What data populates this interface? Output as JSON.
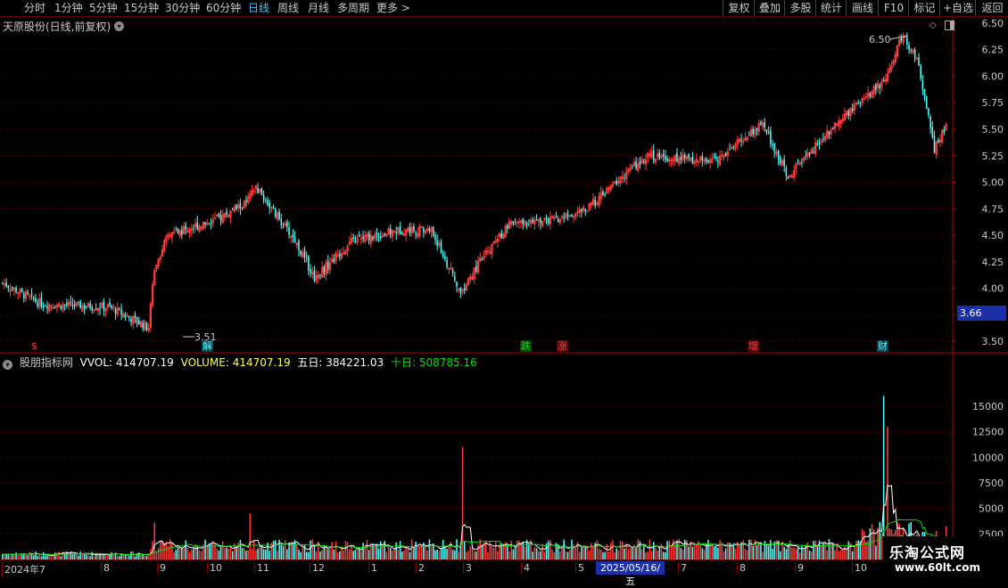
{
  "toolbar": {
    "periods": [
      "分时",
      "1分钟",
      "5分钟",
      "15分钟",
      "30分钟",
      "60分钟",
      "日线",
      "周线",
      "月线",
      "多周期",
      "更多 >"
    ],
    "active": "日线",
    "actions": [
      "复权",
      "叠加",
      "多股",
      "统计",
      "画线",
      "F10",
      "标记",
      "+自选",
      "返回"
    ]
  },
  "title": "天原股份(日线,前复权)",
  "indicator": {
    "name": "股朋指标网",
    "vol": "VVOL: 414707.19",
    "volume": "VOLUME: 414707.19",
    "ma5": "五日: 384221.03",
    "ma10": "十日: 508785.16"
  },
  "colors": {
    "up": "#ff3c3c",
    "down": "#54ffff",
    "ma5": "#ffffff",
    "ma10": "#00e000",
    "axis": "#b00000",
    "grid": "#6a0000"
  },
  "price_tag": "3.66",
  "high_label": "6.50",
  "low_label": "3.51",
  "events": [
    {
      "label": "$",
      "color": "#ff3c3c"
    },
    {
      "label": "解",
      "color": "#54ffff"
    },
    {
      "label": "跌",
      "color": "#00e000"
    },
    {
      "label": "涨",
      "color": "#ff3c3c"
    },
    {
      "label": "增",
      "color": "#ff3c3c"
    },
    {
      "label": "财",
      "color": "#54ffff"
    }
  ],
  "date_axis": [
    "2024年7",
    "8",
    "9",
    "10",
    "11",
    "12",
    "1",
    "2",
    "3",
    "4",
    "5",
    "7",
    "8",
    "9",
    "10"
  ],
  "date_highlight": "2025/05/16/五",
  "watermark": {
    "line1": "乐淘公式网",
    "line2": "www.60lt.com"
  },
  "chart_data": [
    {
      "type": "candlestick",
      "title": "天原股份(日线,前复权)",
      "y_ticks": [
        "6.50",
        "6.25",
        "6.00",
        "5.75",
        "5.50",
        "5.25",
        "5.00",
        "4.75",
        "4.50",
        "4.25",
        "4.00",
        "3.75",
        "3.50"
      ],
      "ylim": [
        3.4,
        6.55
      ],
      "series": [
        {
          "name": "close_approx",
          "keypoints": [
            [
              0,
              4.05
            ],
            [
              20,
              3.85
            ],
            [
              55,
              3.82
            ],
            [
              75,
              3.63
            ],
            [
              78,
              4.2
            ],
            [
              85,
              4.5
            ],
            [
              110,
              4.65
            ],
            [
              125,
              4.8
            ],
            [
              130,
              4.95
            ],
            [
              150,
              4.45
            ],
            [
              160,
              4.1
            ],
            [
              180,
              4.45
            ],
            [
              205,
              4.55
            ],
            [
              220,
              4.55
            ],
            [
              235,
              3.95
            ],
            [
              245,
              4.25
            ],
            [
              260,
              4.6
            ],
            [
              285,
              4.65
            ],
            [
              300,
              4.75
            ],
            [
              330,
              5.25
            ],
            [
              365,
              5.2
            ],
            [
              390,
              5.55
            ],
            [
              403,
              5.05
            ],
            [
              430,
              5.6
            ],
            [
              452,
              5.95
            ],
            [
              462,
              6.4
            ],
            [
              470,
              6.1
            ],
            [
              478,
              5.3
            ],
            [
              484,
              5.55
            ]
          ],
          "low": 3.51,
          "high": 6.5
        }
      ]
    },
    {
      "type": "bar",
      "title": "VOLUME",
      "y_ticks": [
        "15000",
        "12500",
        "10000",
        "7500",
        "5000",
        "2500"
      ],
      "ylim": [
        0,
        19000
      ],
      "series": [
        {
          "name": "VOLUME",
          "last": 414707.19
        },
        {
          "name": "五日",
          "last": 384221.03
        },
        {
          "name": "十日",
          "last": 508785.16
        }
      ],
      "spikes": [
        [
          78,
          3600
        ],
        [
          127,
          4500
        ],
        [
          236,
          11000
        ],
        [
          452,
          16000
        ],
        [
          454,
          13000
        ]
      ]
    }
  ]
}
